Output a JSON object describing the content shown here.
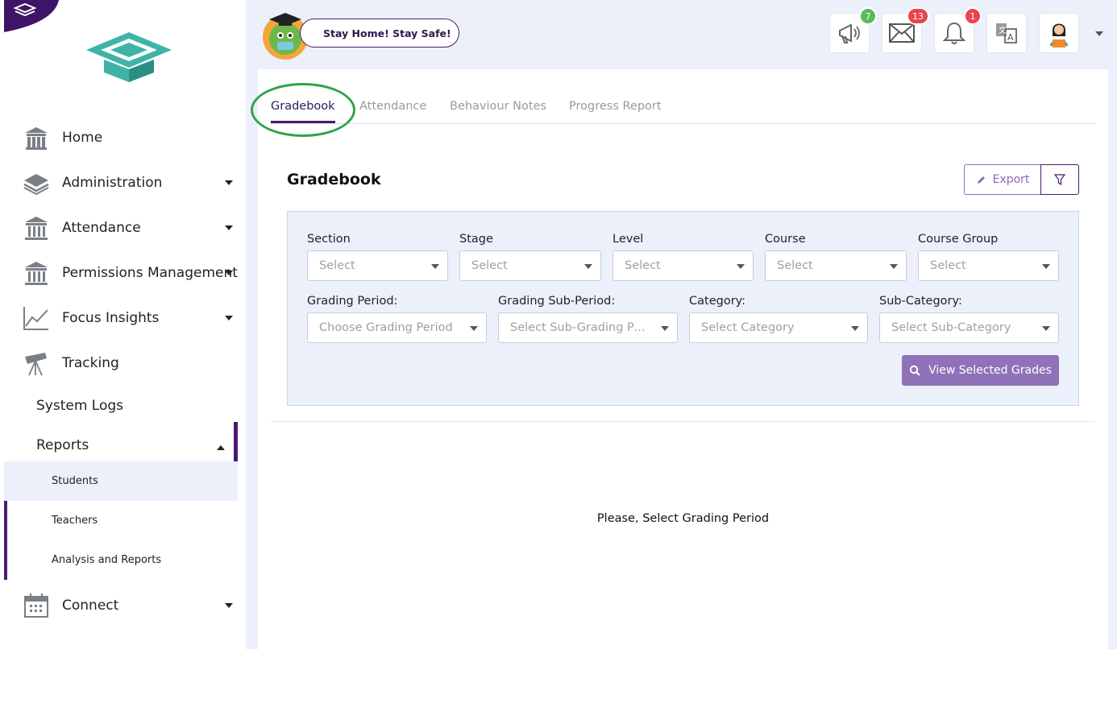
{
  "sidebar": {
    "nav": [
      {
        "label": "Home",
        "icon": "school-building-icon",
        "has_caret": false
      },
      {
        "label": "Administration",
        "icon": "layers-icon",
        "has_caret": true
      },
      {
        "label": "Attendance",
        "icon": "institution-icon",
        "has_caret": true
      },
      {
        "label": "Permissions Management",
        "icon": "institution-icon",
        "has_caret": true
      },
      {
        "label": "Focus Insights",
        "icon": "line-chart-icon",
        "has_caret": true
      },
      {
        "label": "Tracking",
        "icon": "telescope-icon",
        "has_caret": false
      }
    ],
    "system_logs": "System Logs",
    "reports": {
      "label": "Reports",
      "expanded": true,
      "items": [
        "Students",
        "Teachers",
        "Analysis and Reports"
      ],
      "active_item": "Students"
    },
    "connect": {
      "label": "Connect",
      "icon": "calendar-icon"
    }
  },
  "header": {
    "banner": "Stay Home! Stay Safe!",
    "buttons": [
      {
        "name": "announcements",
        "icon": "megaphone-icon",
        "badge": "7",
        "badge_color": "#5cb85c"
      },
      {
        "name": "messages",
        "icon": "envelope-icon",
        "badge": "13",
        "badge_color": "#e8454a"
      },
      {
        "name": "notifications",
        "icon": "bell-icon",
        "badge": "1",
        "badge_color": "#e8454a"
      },
      {
        "name": "language",
        "icon": "translate-icon",
        "badge": null
      },
      {
        "name": "user",
        "icon": "user-avatar-icon",
        "badge": null
      }
    ]
  },
  "tabs": [
    "Gradebook",
    "Attendance",
    "Behaviour Notes",
    "Progress Report"
  ],
  "active_tab": "Gradebook",
  "main": {
    "title": "Gradebook",
    "export_label": "Export",
    "filters_row1": [
      {
        "label": "Section",
        "value": "Select"
      },
      {
        "label": "Stage",
        "value": "Select"
      },
      {
        "label": "Level",
        "value": "Select"
      },
      {
        "label": "Course",
        "value": "Select"
      },
      {
        "label": "Course Group",
        "value": "Select"
      }
    ],
    "filters_row2": [
      {
        "label": "Grading Period:",
        "value": "Choose Grading Period"
      },
      {
        "label": "Grading Sub-Period:",
        "value": "Select Sub-Grading Per..."
      },
      {
        "label": "Category:",
        "value": "Select Category"
      },
      {
        "label": "Sub-Category:",
        "value": "Select Sub-Category"
      }
    ],
    "view_button": "View Selected Grades",
    "empty_message": "Please, Select Grading Period"
  },
  "colors": {
    "accent": "#4b1a74",
    "button": "#8f72b8",
    "panel": "#ecf0fb",
    "highlight": "#2fa44a"
  }
}
